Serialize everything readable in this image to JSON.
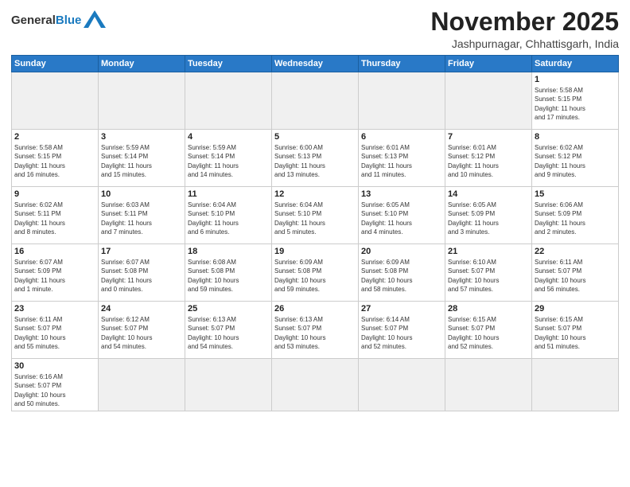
{
  "header": {
    "logo_general": "General",
    "logo_blue": "Blue",
    "month_year": "November 2025",
    "location": "Jashpurnagar, Chhattisgarh, India"
  },
  "days_of_week": [
    "Sunday",
    "Monday",
    "Tuesday",
    "Wednesday",
    "Thursday",
    "Friday",
    "Saturday"
  ],
  "weeks": [
    [
      {
        "day": "",
        "info": ""
      },
      {
        "day": "",
        "info": ""
      },
      {
        "day": "",
        "info": ""
      },
      {
        "day": "",
        "info": ""
      },
      {
        "day": "",
        "info": ""
      },
      {
        "day": "",
        "info": ""
      },
      {
        "day": "1",
        "info": "Sunrise: 5:58 AM\nSunset: 5:15 PM\nDaylight: 11 hours\nand 17 minutes."
      }
    ],
    [
      {
        "day": "2",
        "info": "Sunrise: 5:58 AM\nSunset: 5:15 PM\nDaylight: 11 hours\nand 16 minutes."
      },
      {
        "day": "3",
        "info": "Sunrise: 5:59 AM\nSunset: 5:14 PM\nDaylight: 11 hours\nand 15 minutes."
      },
      {
        "day": "4",
        "info": "Sunrise: 5:59 AM\nSunset: 5:14 PM\nDaylight: 11 hours\nand 14 minutes."
      },
      {
        "day": "5",
        "info": "Sunrise: 6:00 AM\nSunset: 5:13 PM\nDaylight: 11 hours\nand 13 minutes."
      },
      {
        "day": "6",
        "info": "Sunrise: 6:01 AM\nSunset: 5:13 PM\nDaylight: 11 hours\nand 11 minutes."
      },
      {
        "day": "7",
        "info": "Sunrise: 6:01 AM\nSunset: 5:12 PM\nDaylight: 11 hours\nand 10 minutes."
      },
      {
        "day": "8",
        "info": "Sunrise: 6:02 AM\nSunset: 5:12 PM\nDaylight: 11 hours\nand 9 minutes."
      }
    ],
    [
      {
        "day": "9",
        "info": "Sunrise: 6:02 AM\nSunset: 5:11 PM\nDaylight: 11 hours\nand 8 minutes."
      },
      {
        "day": "10",
        "info": "Sunrise: 6:03 AM\nSunset: 5:11 PM\nDaylight: 11 hours\nand 7 minutes."
      },
      {
        "day": "11",
        "info": "Sunrise: 6:04 AM\nSunset: 5:10 PM\nDaylight: 11 hours\nand 6 minutes."
      },
      {
        "day": "12",
        "info": "Sunrise: 6:04 AM\nSunset: 5:10 PM\nDaylight: 11 hours\nand 5 minutes."
      },
      {
        "day": "13",
        "info": "Sunrise: 6:05 AM\nSunset: 5:10 PM\nDaylight: 11 hours\nand 4 minutes."
      },
      {
        "day": "14",
        "info": "Sunrise: 6:05 AM\nSunset: 5:09 PM\nDaylight: 11 hours\nand 3 minutes."
      },
      {
        "day": "15",
        "info": "Sunrise: 6:06 AM\nSunset: 5:09 PM\nDaylight: 11 hours\nand 2 minutes."
      }
    ],
    [
      {
        "day": "16",
        "info": "Sunrise: 6:07 AM\nSunset: 5:09 PM\nDaylight: 11 hours\nand 1 minute."
      },
      {
        "day": "17",
        "info": "Sunrise: 6:07 AM\nSunset: 5:08 PM\nDaylight: 11 hours\nand 0 minutes."
      },
      {
        "day": "18",
        "info": "Sunrise: 6:08 AM\nSunset: 5:08 PM\nDaylight: 10 hours\nand 59 minutes."
      },
      {
        "day": "19",
        "info": "Sunrise: 6:09 AM\nSunset: 5:08 PM\nDaylight: 10 hours\nand 59 minutes."
      },
      {
        "day": "20",
        "info": "Sunrise: 6:09 AM\nSunset: 5:08 PM\nDaylight: 10 hours\nand 58 minutes."
      },
      {
        "day": "21",
        "info": "Sunrise: 6:10 AM\nSunset: 5:07 PM\nDaylight: 10 hours\nand 57 minutes."
      },
      {
        "day": "22",
        "info": "Sunrise: 6:11 AM\nSunset: 5:07 PM\nDaylight: 10 hours\nand 56 minutes."
      }
    ],
    [
      {
        "day": "23",
        "info": "Sunrise: 6:11 AM\nSunset: 5:07 PM\nDaylight: 10 hours\nand 55 minutes."
      },
      {
        "day": "24",
        "info": "Sunrise: 6:12 AM\nSunset: 5:07 PM\nDaylight: 10 hours\nand 54 minutes."
      },
      {
        "day": "25",
        "info": "Sunrise: 6:13 AM\nSunset: 5:07 PM\nDaylight: 10 hours\nand 54 minutes."
      },
      {
        "day": "26",
        "info": "Sunrise: 6:13 AM\nSunset: 5:07 PM\nDaylight: 10 hours\nand 53 minutes."
      },
      {
        "day": "27",
        "info": "Sunrise: 6:14 AM\nSunset: 5:07 PM\nDaylight: 10 hours\nand 52 minutes."
      },
      {
        "day": "28",
        "info": "Sunrise: 6:15 AM\nSunset: 5:07 PM\nDaylight: 10 hours\nand 52 minutes."
      },
      {
        "day": "29",
        "info": "Sunrise: 6:15 AM\nSunset: 5:07 PM\nDaylight: 10 hours\nand 51 minutes."
      }
    ],
    [
      {
        "day": "30",
        "info": "Sunrise: 6:16 AM\nSunset: 5:07 PM\nDaylight: 10 hours\nand 50 minutes."
      },
      {
        "day": "",
        "info": ""
      },
      {
        "day": "",
        "info": ""
      },
      {
        "day": "",
        "info": ""
      },
      {
        "day": "",
        "info": ""
      },
      {
        "day": "",
        "info": ""
      },
      {
        "day": "",
        "info": ""
      }
    ]
  ]
}
